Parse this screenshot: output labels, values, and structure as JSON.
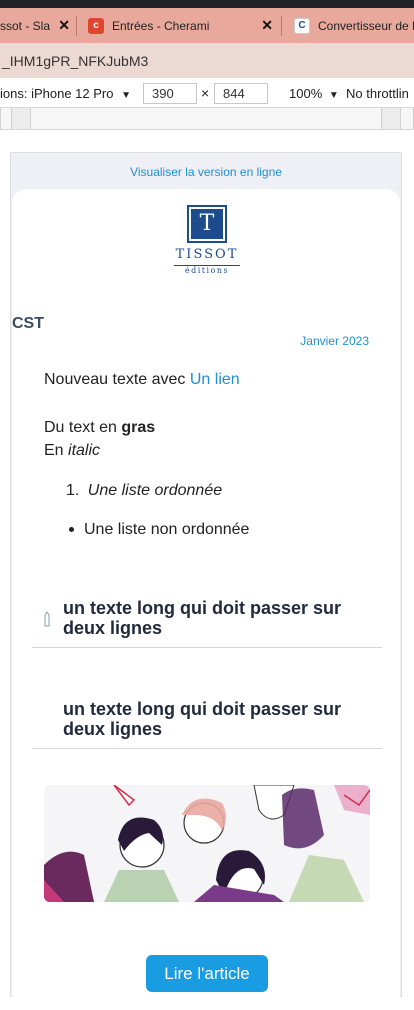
{
  "browser": {
    "tabs": [
      {
        "label": "ssot - Sla",
        "favicon_letter": "",
        "favicon_color": "#e8a89c"
      },
      {
        "label": "Entrées - Cherami",
        "favicon_letter": "c",
        "favicon_color": "#e2452e"
      },
      {
        "label": "Convertisseur de P",
        "favicon_letter": "C",
        "favicon_color": "#ffffff"
      }
    ],
    "url_fragment": "_IHM1gPR_NFKJubM3",
    "devtools": {
      "device_label": "ions: iPhone 12 Pro",
      "width_value": "390",
      "height_value": "844",
      "times_sign": "×",
      "zoom": "100%",
      "throttle": "No throttlin"
    }
  },
  "email": {
    "view_online": "Visualiser la version en ligne",
    "logo": {
      "letter": "T",
      "name": "TISSOT",
      "sub": "éditions"
    },
    "section_label": "CST",
    "date": "Janvier 2023",
    "para1_text": "Nouveau texte avec ",
    "para1_link": "Un lien",
    "bold_prefix": "Du text en ",
    "bold_word": "gras",
    "italic_prefix": "En ",
    "italic_word": "italic",
    "ordered_number": "1.",
    "ordered_item": "Une liste ordonnée",
    "unordered_item": "Une liste non ordonnée",
    "heading1": "un texte long qui doit passer sur deux lignes",
    "heading2": "un texte long qui doit passer sur deux lignes",
    "cta_label": "Lire l'article"
  },
  "colors": {
    "link": "#1f8fd0",
    "cta": "#1a9ce2",
    "brand": "#1d4c8e",
    "tab_bar": "#e8a89c"
  }
}
